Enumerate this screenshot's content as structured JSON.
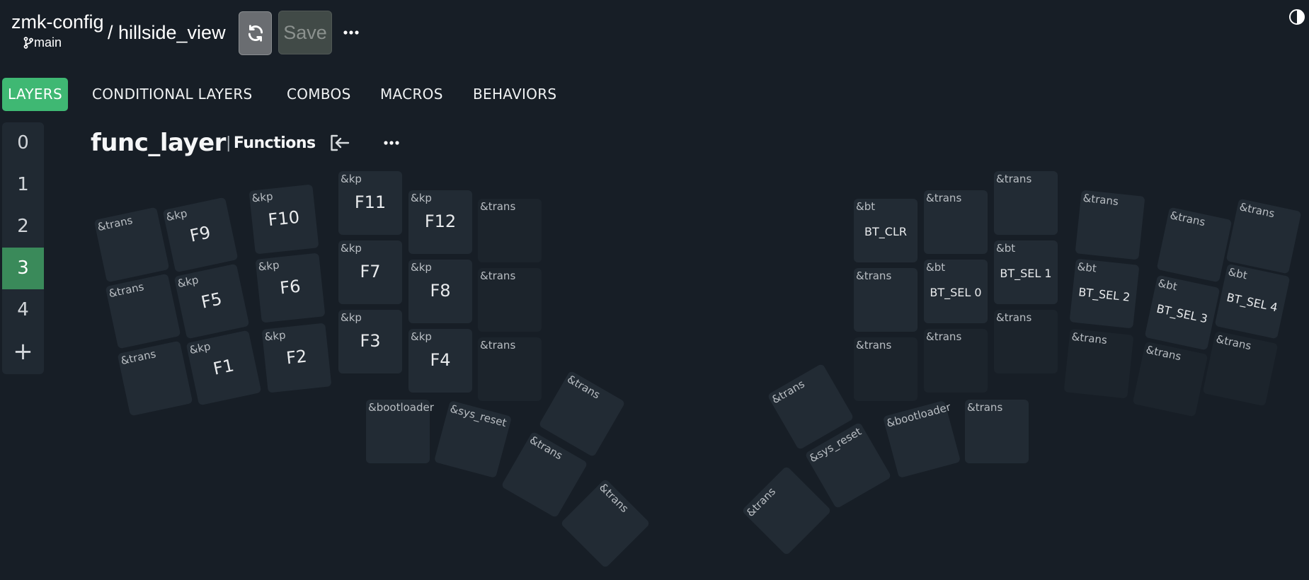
{
  "header": {
    "repo": "zmk-config",
    "branch": "main",
    "separator_name": "/ hillside_view",
    "save_label": "Save"
  },
  "tabs": [
    "LAYERS",
    "CONDITIONAL LAYERS",
    "COMBOS",
    "MACROS",
    "BEHAVIORS"
  ],
  "layers": {
    "items": [
      "0",
      "1",
      "2",
      "3",
      "4"
    ],
    "selected": "3",
    "add_label": "+"
  },
  "layer": {
    "name": "func_layer",
    "label": "Functions"
  },
  "icons": {
    "branch": "git-branch-icon",
    "refresh": "refresh-icon",
    "more": "more-horizontal-icon",
    "theme": "contrast-theme-icon",
    "exit_layer": "layer-exit-icon"
  },
  "colors": {
    "background": "#171e26",
    "accent": "#3fb873",
    "selected_layer": "#3a8a5a",
    "key": "#222b34"
  },
  "keys": [
    {
      "b": "&trans",
      "p": ""
    },
    {
      "b": "&kp",
      "p": "F9"
    },
    {
      "b": "&kp",
      "p": "F10"
    },
    {
      "b": "&kp",
      "p": "F11"
    },
    {
      "b": "&kp",
      "p": "F12"
    },
    {
      "b": "&trans",
      "p": ""
    },
    {
      "b": "&trans",
      "p": ""
    },
    {
      "b": "&kp",
      "p": "F5"
    },
    {
      "b": "&kp",
      "p": "F6"
    },
    {
      "b": "&kp",
      "p": "F7"
    },
    {
      "b": "&kp",
      "p": "F8"
    },
    {
      "b": "&trans",
      "p": ""
    },
    {
      "b": "&trans",
      "p": ""
    },
    {
      "b": "&kp",
      "p": "F1"
    },
    {
      "b": "&kp",
      "p": "F2"
    },
    {
      "b": "&kp",
      "p": "F3"
    },
    {
      "b": "&kp",
      "p": "F4"
    },
    {
      "b": "&trans",
      "p": ""
    },
    {
      "b": "&trans",
      "p": ""
    },
    {
      "b": "&bootloader",
      "p": ""
    },
    {
      "b": "&sys_reset",
      "p": ""
    },
    {
      "b": "&trans",
      "p": ""
    },
    {
      "b": "&trans",
      "p": ""
    },
    {
      "b": "&bt",
      "p": "BT_CLR"
    },
    {
      "b": "&trans",
      "p": ""
    },
    {
      "b": "&trans",
      "p": ""
    },
    {
      "b": "&trans",
      "p": ""
    },
    {
      "b": "&trans",
      "p": ""
    },
    {
      "b": "&trans",
      "p": ""
    },
    {
      "b": "&trans",
      "p": ""
    },
    {
      "b": "&bt",
      "p": "BT_SEL 0"
    },
    {
      "b": "&bt",
      "p": "BT_SEL 1"
    },
    {
      "b": "&bt",
      "p": "BT_SEL 2"
    },
    {
      "b": "&bt",
      "p": "BT_SEL 3"
    },
    {
      "b": "&bt",
      "p": "BT_SEL 4"
    },
    {
      "b": "&trans",
      "p": ""
    },
    {
      "b": "&trans",
      "p": ""
    },
    {
      "b": "&trans",
      "p": ""
    },
    {
      "b": "&trans",
      "p": ""
    },
    {
      "b": "&trans",
      "p": ""
    },
    {
      "b": "&trans",
      "p": ""
    },
    {
      "b": "&trans",
      "p": ""
    },
    {
      "b": "&trans",
      "p": ""
    },
    {
      "b": "&sys_reset",
      "p": ""
    },
    {
      "b": "&bootloader",
      "p": ""
    },
    {
      "b": "&trans",
      "p": ""
    }
  ]
}
